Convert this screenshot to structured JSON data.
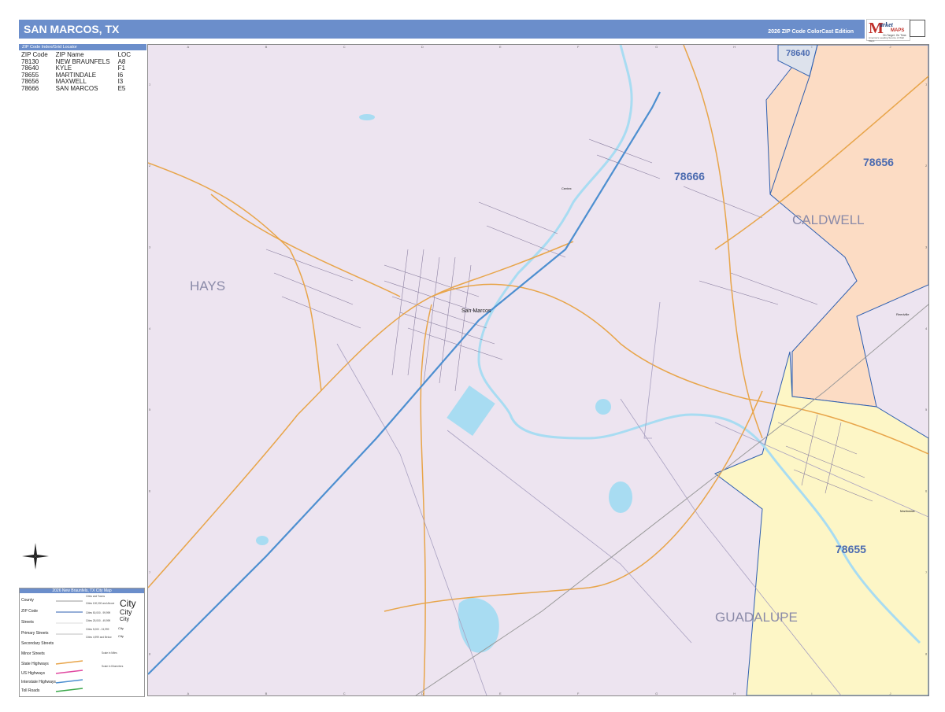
{
  "header": {
    "title": "SAN MARCOS, TX",
    "edition": "2026 ZIP Code ColorCast Edition",
    "logo_text": "Market MAPS",
    "logo_tagline": "On Target. On Time.",
    "logo_sub": "America's Leading Source of Wall Maps"
  },
  "index": {
    "heading": "ZIP Code Index/Grid Locator",
    "columns": [
      "ZIP Code",
      "ZIP Name",
      "LOC"
    ],
    "rows": [
      [
        "78130",
        "NEW BRAUNFELS",
        "A8"
      ],
      [
        "78640",
        "KYLE",
        "F1"
      ],
      [
        "78655",
        "MARTINDALE",
        "I6"
      ],
      [
        "78656",
        "MAXWELL",
        "I3"
      ],
      [
        "78666",
        "SAN MARCOS",
        "E5"
      ]
    ]
  },
  "map": {
    "zip_labels": [
      "78640",
      "78666",
      "78656",
      "78655"
    ],
    "county_labels": [
      "HAYS",
      "CALDWELL",
      "GUADALUPE"
    ],
    "city_label": "San Marcos",
    "small_labels": [
      "Centex",
      "Reedville",
      "Martindale"
    ],
    "colors": {
      "zip_78666": "#ede4f0",
      "zip_78656": "#fcdcc4",
      "zip_78655": "#fdf6c6",
      "zip_78640": "#dde2ec",
      "water": "#a8dcf2",
      "interstate": "#4d8fd0",
      "highway": "#e8a54a",
      "zip_boundary": "#2e5fb0"
    },
    "grid_top": [
      "A",
      "B",
      "C",
      "D",
      "E",
      "F",
      "G",
      "H",
      "I",
      "J"
    ],
    "grid_side": [
      "1",
      "2",
      "3",
      "4",
      "5",
      "6",
      "7",
      "8"
    ]
  },
  "legend": {
    "heading": "2026 New Braunfels, TX City Map",
    "rows": [
      "County",
      "ZIP Code",
      "Streets",
      "Primary Streets",
      "Secondary Streets",
      "Minor Streets",
      "State Highways",
      "US Highways",
      "Interstate Highways",
      "Toll Roads"
    ],
    "cities_heading": "Cities and Towns",
    "city_sizes": [
      "Cities 100,000 and Above",
      "Cities 50,000 - 99,999",
      "Cities 25,000 - 49,999",
      "Cities 5,000 - 24,999",
      "Cities 4,999 and Below"
    ],
    "city_samples": [
      "City",
      "City",
      "City",
      "City",
      "City"
    ],
    "scale_miles": "Scale in Miles",
    "scale_km": "Scale in Kilometers"
  }
}
